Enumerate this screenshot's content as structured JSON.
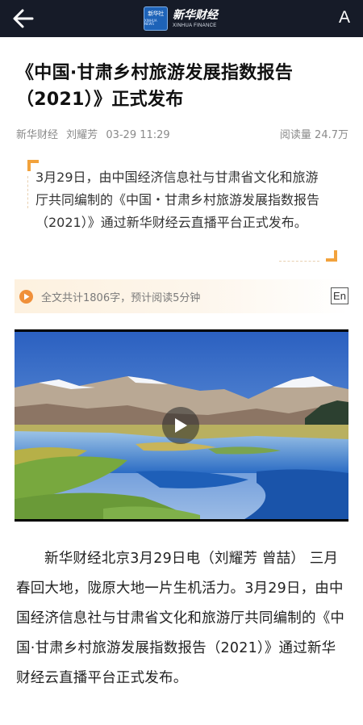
{
  "header": {
    "back_icon": "arrow-left-icon",
    "brand_box_top": "新华社",
    "brand_box_bottom": "XINHUA NEWS",
    "brand_cn": "新华财经",
    "brand_en": "XINHUA FINANCE",
    "font_size_label": "A"
  },
  "article": {
    "title": "《中国·甘肃乡村旅游发展指数报告（2021）》正式发布",
    "source": "新华财经",
    "author": "刘耀芳",
    "datetime": "03-29 11:29",
    "read_count": "阅读量 24.7万",
    "summary": "3月29日，由中国经济信息社与甘肃省文化和旅游厅共同编制的《中国・甘肃乡村旅游发展指数报告（2021）》通过新华财经云直播平台正式发布。",
    "read_info": "全文共计1806字，预计阅读5分钟",
    "en_label": "En",
    "body": "新华财经北京3月29日电（刘耀芳 曾喆） 三月春回大地，陇原大地一片生机活力。3月29日，由中国经济信息社与甘肃省文化和旅游厅共同编制的《中国·甘肃乡村旅游发展指数报告（2021）》通过新华财经云直播平台正式发布。"
  },
  "colors": {
    "topbar": "#161b28",
    "accent_orange": "#f2a23c",
    "meta_gray": "#8a8a8a"
  }
}
